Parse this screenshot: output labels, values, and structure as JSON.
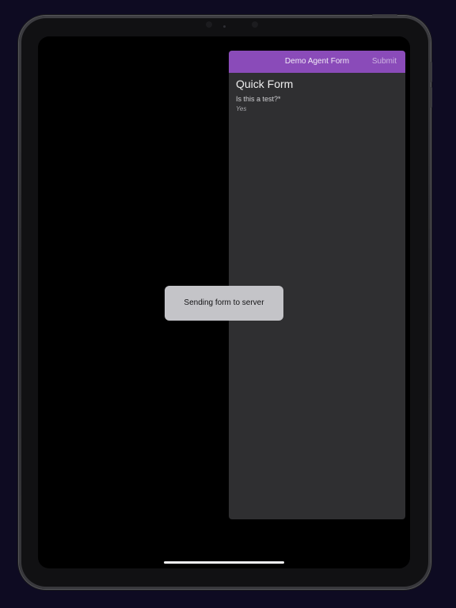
{
  "form": {
    "nav_title": "Demo Agent Form",
    "submit_label": "Submit",
    "heading": "Quick Form",
    "question": {
      "label": "Is this a test?*",
      "answer": "Yes"
    }
  },
  "toast": {
    "message": "Sending form to server"
  },
  "colors": {
    "header_accent": "#8a4bb9",
    "sheet_background": "#2f2f31",
    "toast_background": "#c4c4c8",
    "status_green": "#7fd08a"
  },
  "icons": {
    "status_indicator": "status-dot-icon",
    "battery": "battery-icon"
  }
}
